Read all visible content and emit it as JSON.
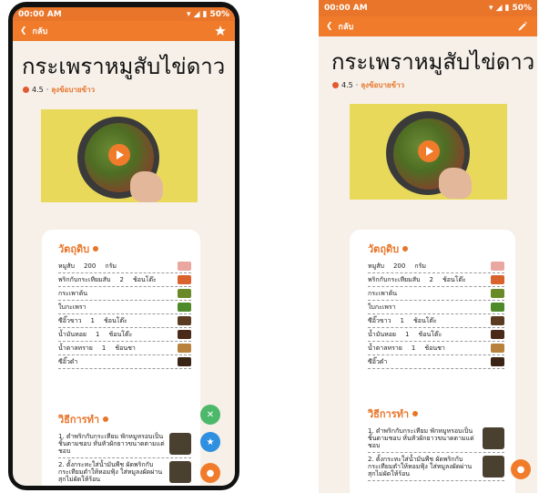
{
  "left": {
    "status": {
      "time": "00:00 AM",
      "battery": "50%"
    },
    "appbar": {
      "back_label": "กลับ",
      "action_icon": "star-icon"
    },
    "recipe": {
      "title": "กระเพราหมูสับไข่ดาว",
      "rating": "4.5",
      "author": "ลุงข้อบายข้าว"
    },
    "ingredients_title": "วัตถุดิบ",
    "ingredients": [
      {
        "name": "หมูสับ",
        "qty": "200",
        "unit": "กรัม",
        "color": "#e9a7a0"
      },
      {
        "name": "พริกกับกระเทียมสับ",
        "qty": "2",
        "unit": "ช้อนโต๊ะ",
        "color": "#d9622d"
      },
      {
        "name": "กระเพาต้น",
        "qty": "",
        "unit": "",
        "color": "#6a8a2a"
      },
      {
        "name": "ใบกะเพรา",
        "qty": "",
        "unit": "",
        "color": "#4f8a2a"
      },
      {
        "name": "ซีอิ๊วขาว",
        "qty": "1",
        "unit": "ช้อนโต๊ะ",
        "color": "#5a3a20"
      },
      {
        "name": "น้ำมันหอย",
        "qty": "1",
        "unit": "ช้อนโต๊ะ",
        "color": "#4a2a18"
      },
      {
        "name": "น้ำตาลทราย",
        "qty": "1",
        "unit": "ช้อนชา",
        "color": "#b8823c"
      },
      {
        "name": "ซีอิ๊วดำ",
        "qty": "",
        "unit": "",
        "color": "#3a2416"
      }
    ],
    "steps_title": "วิธีการทำ",
    "steps": [
      {
        "text": "1. ตำพริกกับกระเทียม พักหมูหรอบเป็นชิ้นตามชอบ หั่นหัวผักยาวขนาดตามแต่ชอบ"
      },
      {
        "text": "2. ตั้งกระทะใส่น้ำมันพืช ผัดพริกกับกระเทียมตำให้หอมฟุ้ง ใส่หมูลงผัดผ่านสุกไม่ผัดให้ร้อน"
      }
    ]
  },
  "right": {
    "status": {
      "time": "00:00 AM",
      "battery": "50%"
    },
    "appbar": {
      "back_label": "กลับ",
      "action_icon": "edit-pencil-icon"
    },
    "recipe": {
      "title": "กระเพราหมูสับไข่ดาว",
      "rating": "4.5",
      "author": "ลุงข้อบายข้าว"
    },
    "ingredients_title": "วัตถุดิบ",
    "ingredients": [
      {
        "name": "หมูสับ",
        "qty": "200",
        "unit": "กรัม",
        "color": "#e9a7a0"
      },
      {
        "name": "พริกกับกระเทียมสับ",
        "qty": "2",
        "unit": "ช้อนโต๊ะ",
        "color": "#d9622d"
      },
      {
        "name": "กระเพาต้น",
        "qty": "",
        "unit": "",
        "color": "#6a8a2a"
      },
      {
        "name": "ใบกะเพรา",
        "qty": "",
        "unit": "",
        "color": "#4f8a2a"
      },
      {
        "name": "ซีอิ๊วขาว",
        "qty": "1",
        "unit": "ช้อนโต๊ะ",
        "color": "#5a3a20"
      },
      {
        "name": "น้ำมันหอย",
        "qty": "1",
        "unit": "ช้อนโต๊ะ",
        "color": "#4a2a18"
      },
      {
        "name": "น้ำตาลทราย",
        "qty": "1",
        "unit": "ช้อนชา",
        "color": "#b8823c"
      },
      {
        "name": "ซีอิ๊วดำ",
        "qty": "",
        "unit": "",
        "color": "#3a2416"
      }
    ],
    "steps_title": "วิธีการทำ",
    "steps": [
      {
        "text": "1. ตำพริกกับกระเทียม พักหมูหรอบเป็นชิ้นตามชอบ หั่นหัวผักยาวขนาดตามแต่ชอบ"
      },
      {
        "text": "2. ตั้งกระทะใส่น้ำมันพืช ผัดพริกกับกระเทียมตำให้หอมฟุ้ง ใส่หมูลงผัดผ่านสุกไม่ผัดให้ร้อน"
      }
    ]
  },
  "fabs": {
    "left": [
      {
        "icon": "utensils-icon",
        "color": "#4cb86a"
      },
      {
        "icon": "star-icon",
        "color": "#2f8fe0"
      },
      {
        "icon": "chat-icon",
        "color": "#f07c2b"
      }
    ],
    "right": [
      {
        "icon": "chat-icon",
        "color": "#f07c2b"
      }
    ]
  },
  "colors": {
    "accent": "#f07c2b",
    "status": "#e8752a",
    "background": "#f6f0e9"
  }
}
